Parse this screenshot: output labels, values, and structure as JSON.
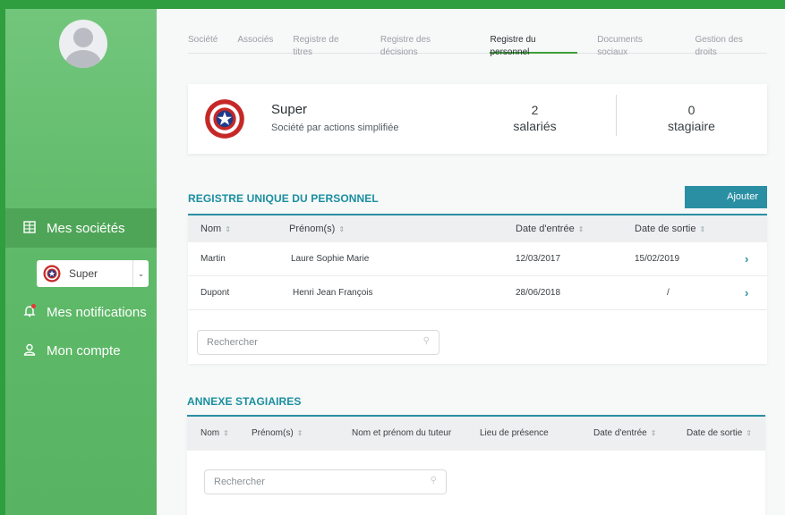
{
  "sidebar": {
    "items": [
      {
        "label": "Mes sociétés",
        "icon": "building-icon"
      },
      {
        "label": "Mes notifications",
        "icon": "bell-icon"
      },
      {
        "label": "Mon compte",
        "icon": "user-icon"
      }
    ],
    "company_select": {
      "value": "Super"
    }
  },
  "tabs": [
    "Société",
    "Associés",
    "Registre de titres",
    "Registre des décisions",
    "Registre du personnel",
    "Documents sociaux",
    "Gestion des droits"
  ],
  "active_tab": "Registre du personnel",
  "company": {
    "name": "Super",
    "type": "Société par actions simplifiée",
    "employees_count": "2",
    "employees_label": "salariés",
    "interns_count": "0",
    "interns_label": "stagiaire"
  },
  "personnel": {
    "title": "REGISTRE UNIQUE DU PERSONNEL",
    "add_label": "Ajouter",
    "columns": [
      "Nom",
      "Prénom(s)",
      "Date d'entrée",
      "Date de sortie"
    ],
    "rows": [
      {
        "nom": "Martin",
        "prenom": "Laure Sophie Marie",
        "entree": "12/03/2017",
        "sortie": "15/02/2019"
      },
      {
        "nom": "Dupont",
        "prenom": "Henri Jean François",
        "entree": "28/06/2018",
        "sortie": "/"
      }
    ],
    "search_placeholder": "Rechercher"
  },
  "interns": {
    "title": "ANNEXE STAGIAIRES",
    "columns": [
      "Nom",
      "Prénom(s)",
      "Nom et prénom du tuteur",
      "Lieu de présence",
      "Date d'entrée",
      "Date de sortie"
    ],
    "search_placeholder": "Rechercher"
  },
  "colors": {
    "sidebar": "#5fba69",
    "accent": "#2a8fa3",
    "tab_active": "#3f9f3a"
  }
}
